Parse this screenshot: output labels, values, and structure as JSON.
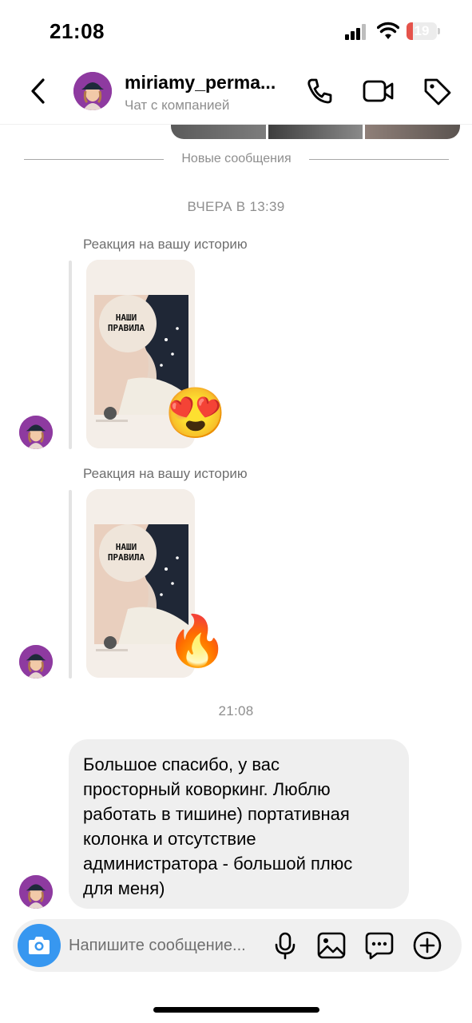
{
  "status_bar": {
    "time": "21:08",
    "battery_level": "19",
    "battery_fraction": 0.19
  },
  "header": {
    "username": "miriamy_perma...",
    "subtitle": "Чат с компанией",
    "icons": [
      "chevron-left-icon",
      "phone-icon",
      "video-camera-icon",
      "tag-icon"
    ]
  },
  "chat": {
    "new_messages_label": "Новые сообщения",
    "yesterday_time": "ВЧЕРА В 13:39",
    "reactions": [
      {
        "label": "Реакция на вашу историю",
        "story_text": [
          "НАШИ",
          "ПРАВИЛА"
        ],
        "emoji": "😍"
      },
      {
        "label": "Реакция на вашу историю",
        "story_text": [
          "НАШИ",
          "ПРАВИЛА"
        ],
        "emoji": "🔥"
      }
    ],
    "today_time": "21:08",
    "message_lines": [
      "Большое спасибо, у вас",
      "просторный коворкинг. Люблю",
      "работать в тишине) портативная",
      "колонка и отсутствие",
      "администратора - большой плюс",
      "для меня)"
    ]
  },
  "composer": {
    "placeholder": "Напишите сообщение...",
    "icons": [
      "camera-icon",
      "microphone-icon",
      "gallery-icon",
      "sticker-chat-icon",
      "plus-circle-icon"
    ]
  },
  "colors": {
    "accent": "#3797f0",
    "bubble": "#efefef",
    "battery": "#e5534b"
  }
}
